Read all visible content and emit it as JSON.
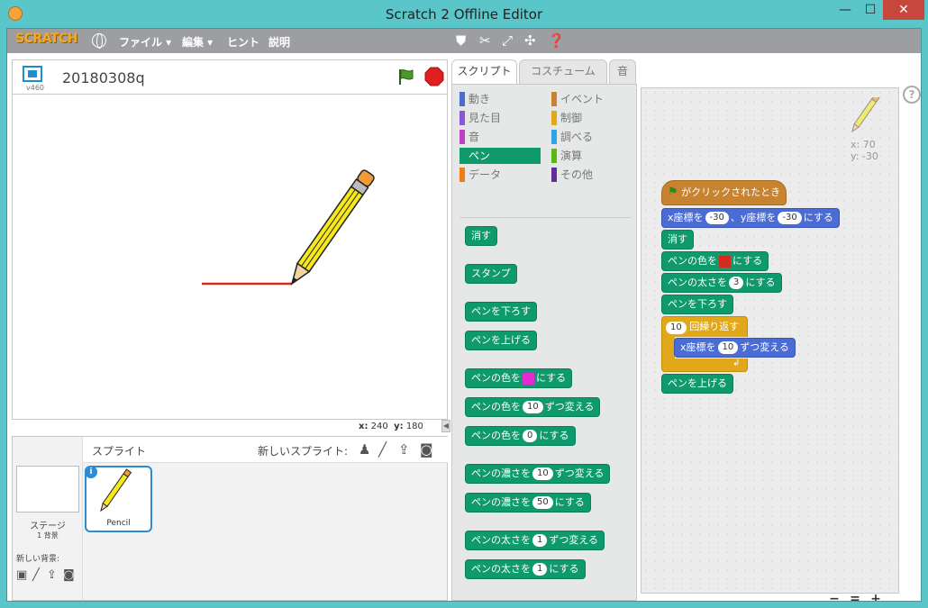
{
  "window": {
    "title": "Scratch 2 Offline Editor",
    "minimize": "—",
    "maximize": "☐",
    "close": "✕"
  },
  "menubar": {
    "logo": "SCRATCH",
    "items": [
      {
        "label": "ファイル ▾"
      },
      {
        "label": "編集 ▾"
      },
      {
        "label": "ヒント"
      },
      {
        "label": "説明"
      }
    ],
    "tools": [
      "duplicate-icon",
      "delete-icon",
      "grow-icon",
      "shrink-icon",
      "help-icon"
    ]
  },
  "stage": {
    "version": "v460",
    "project_name": "20180308q",
    "mouse_x_label": "x:",
    "mouse_x": "240",
    "mouse_y_label": "y:",
    "mouse_y": "180",
    "pen_color": "#d32b1e"
  },
  "sprites": {
    "title": "スプライト",
    "new_sprite_label": "新しいスプライト:",
    "stage_label": "ステージ",
    "backdrop_count": "1 背景",
    "new_backdrop_label": "新しい背景:",
    "items": [
      {
        "name": "Pencil",
        "selected": true
      }
    ]
  },
  "tabs": [
    {
      "label": "スクリプト",
      "active": true
    },
    {
      "label": "コスチューム",
      "active": false
    },
    {
      "label": "音",
      "active": false
    }
  ],
  "categories": {
    "left": [
      {
        "label": "動き",
        "color": "#4a6cd4"
      },
      {
        "label": "見た目",
        "color": "#8a55d7"
      },
      {
        "label": "音",
        "color": "#bb42c3"
      },
      {
        "label": "ペン",
        "color": "#0e9a6c",
        "selected": true
      },
      {
        "label": "データ",
        "color": "#ee7d16"
      }
    ],
    "right": [
      {
        "label": "イベント",
        "color": "#c88330"
      },
      {
        "label": "制御",
        "color": "#e1a91a"
      },
      {
        "label": "調べる",
        "color": "#2ca5e2"
      },
      {
        "label": "演算",
        "color": "#5cb712"
      },
      {
        "label": "その他",
        "color": "#632d99"
      }
    ]
  },
  "palette_blocks": {
    "clear": "消す",
    "stamp": "スタンプ",
    "pen_down": "ペンを下ろす",
    "pen_up": "ペンを上げる",
    "set_color_pre": "ペンの色を",
    "set_color_post": "にする",
    "set_color_swatch": "#e22bd2",
    "change_color_pre": "ペンの色を",
    "change_color_value": "10",
    "change_color_post": "ずつ変える",
    "set_color_num_pre": "ペンの色を",
    "set_color_num_value": "0",
    "set_color_num_post": "にする",
    "change_shade_pre": "ペンの濃さを",
    "change_shade_value": "10",
    "change_shade_post": "ずつ変える",
    "set_shade_pre": "ペンの濃さを",
    "set_shade_value": "50",
    "set_shade_post": "にする",
    "change_size_pre": "ペンの太さを",
    "change_size_value": "1",
    "change_size_post": "ずつ変える",
    "set_size_pre": "ペンの太さを",
    "set_size_value": "1",
    "set_size_post": "にする"
  },
  "script": {
    "sprite_x": "x: 70",
    "sprite_y": "y: -30",
    "hat": "がクリックされたとき",
    "goto_pre": "x座標を",
    "goto_x": "-30",
    "goto_mid": "、y座標を",
    "goto_y": "-30",
    "goto_post": "にする",
    "clear": "消す",
    "set_color_pre": "ペンの色を",
    "set_color_swatch": "#d32b1e",
    "set_color_post": "にする",
    "set_size_pre": "ペンの太さを",
    "set_size_value": "3",
    "set_size_post": "にする",
    "pen_down": "ペンを下ろす",
    "repeat_value": "10",
    "repeat_label": "回繰り返す",
    "change_x_pre": "x座標を",
    "change_x_value": "10",
    "change_x_post": "ずつ変える",
    "pen_up": "ペンを上げる"
  },
  "zoom": {
    "out": "−",
    "reset": "=",
    "in": "+"
  }
}
